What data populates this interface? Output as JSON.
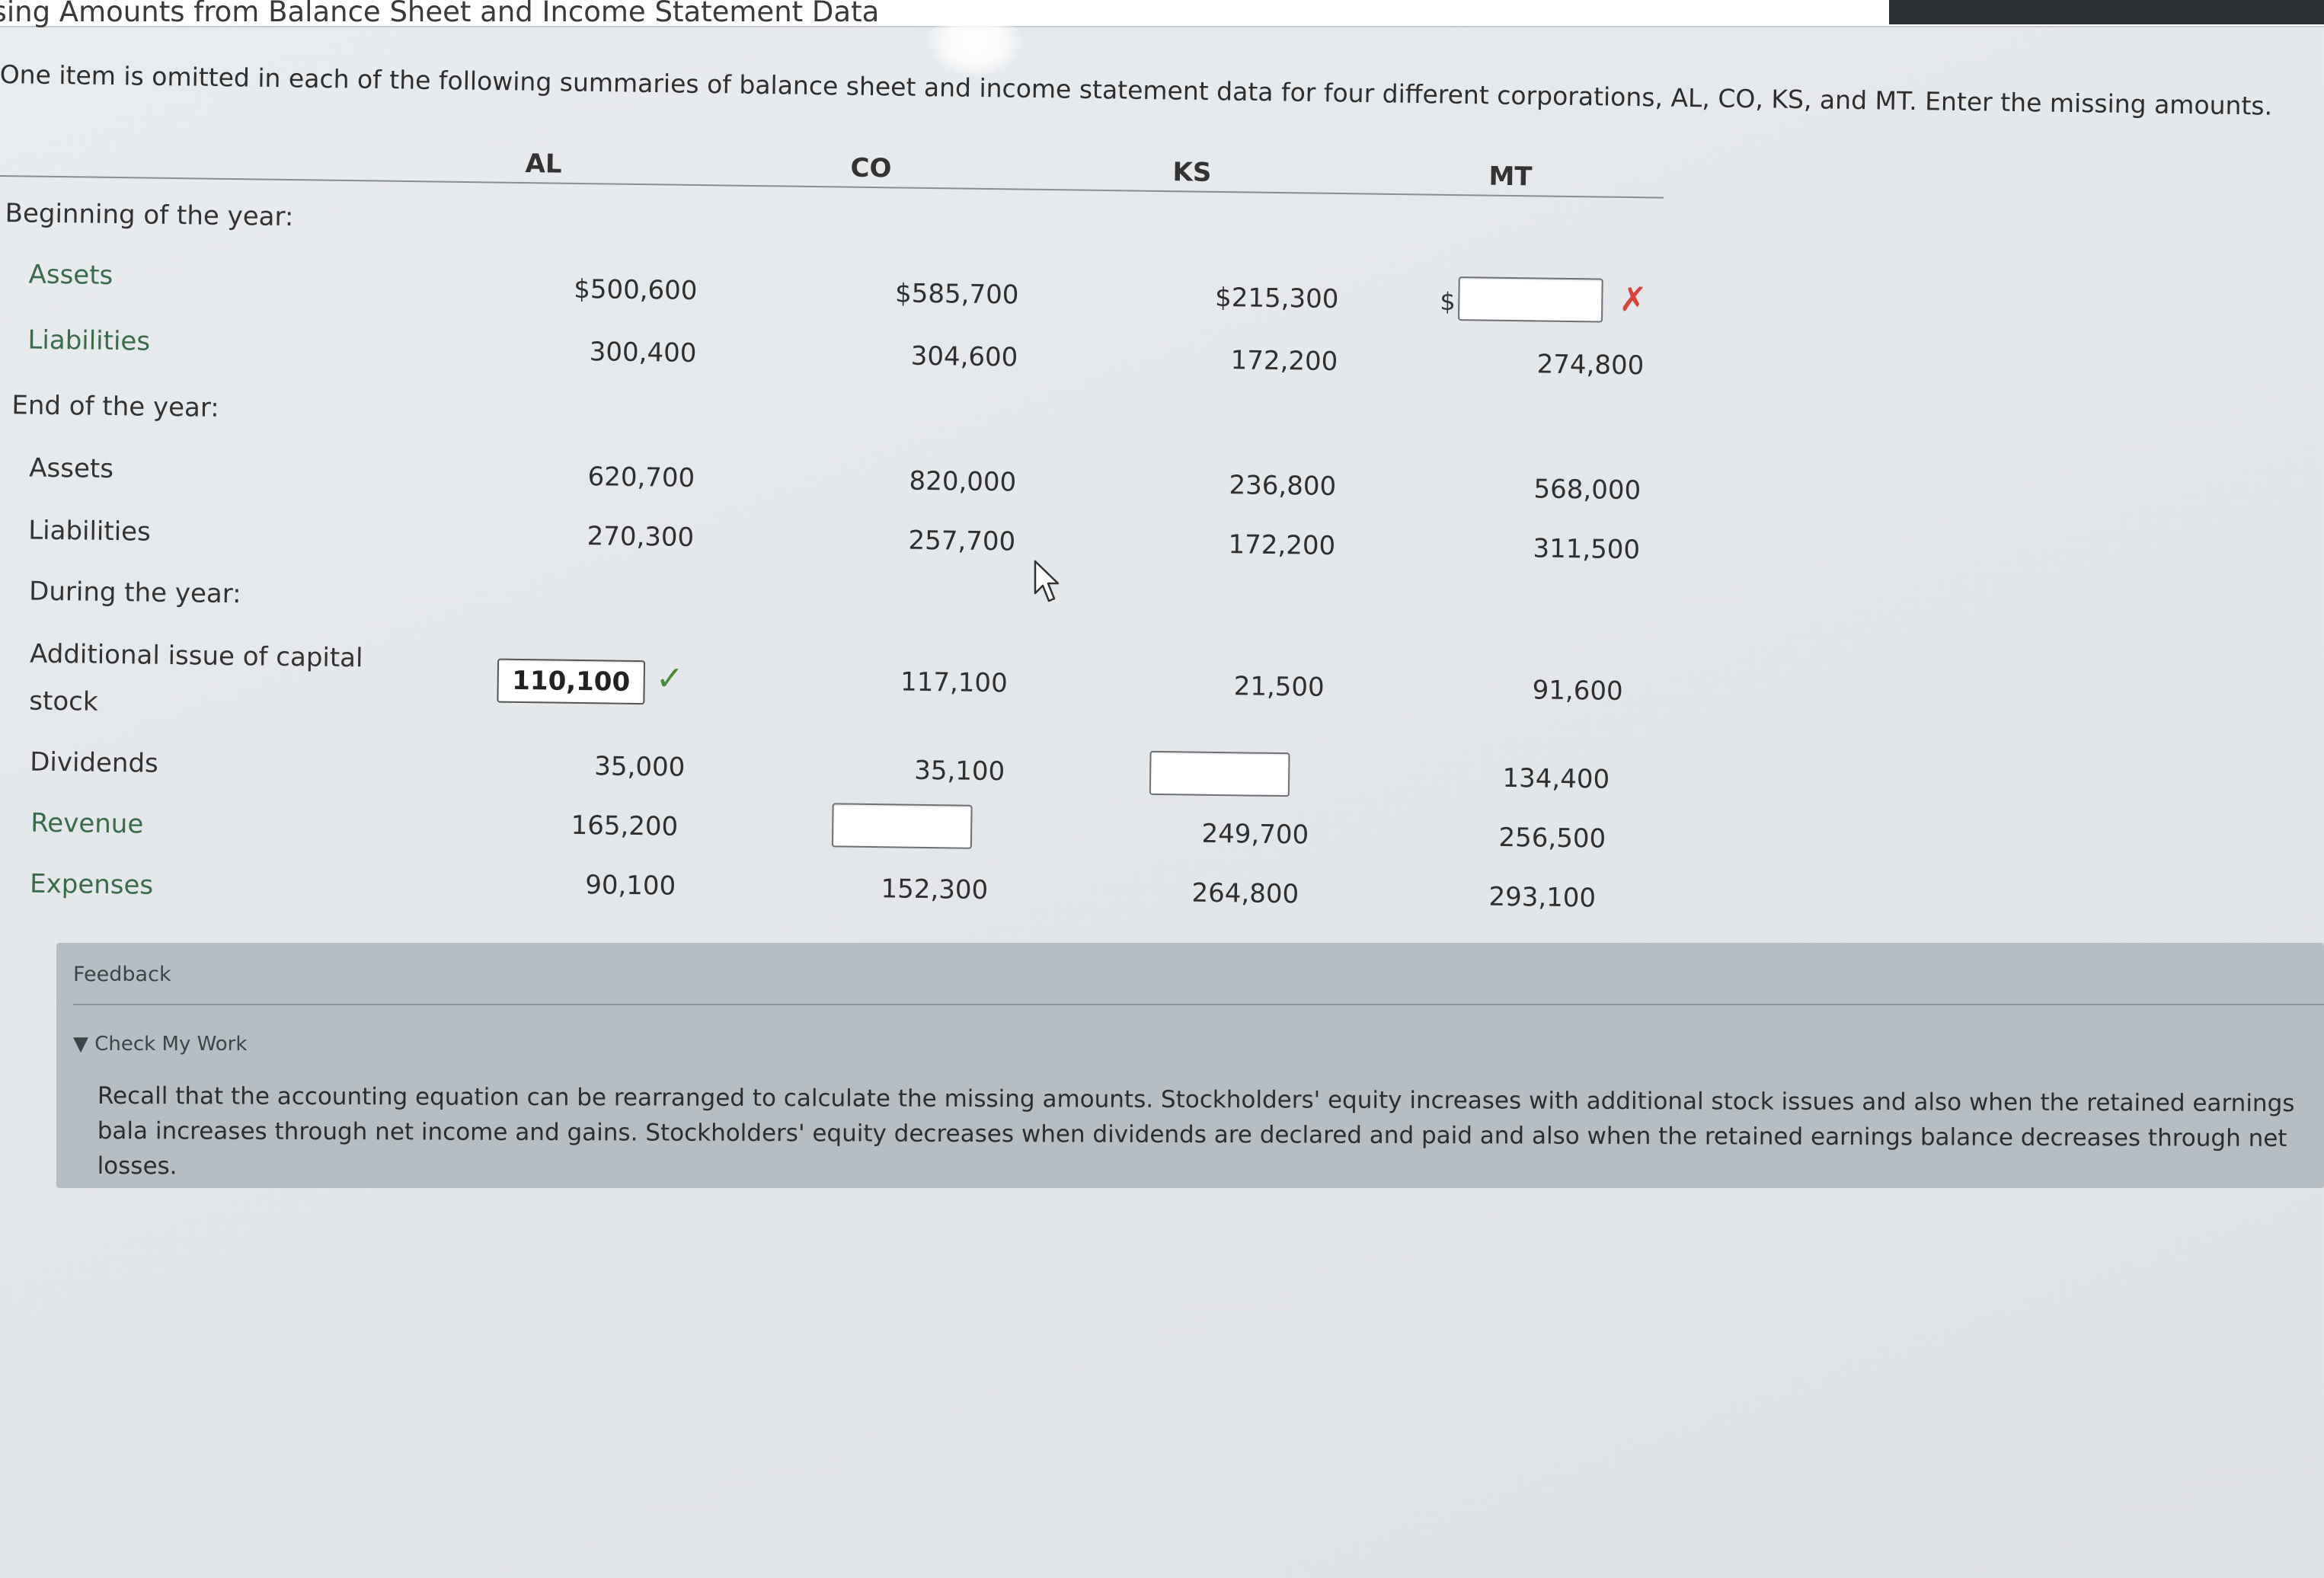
{
  "page": {
    "title": "issing Amounts from Balance Sheet and Income Statement Data",
    "instructions": "One item is omitted in each of the following summaries of balance sheet and income statement data for four different corporations, AL, CO, KS, and MT. Enter the missing amounts."
  },
  "table": {
    "columns": [
      "AL",
      "CO",
      "KS",
      "MT"
    ],
    "sections": {
      "beginning": "Beginning of the year:",
      "end": "End of the year:",
      "during": "During the year:"
    },
    "labels": {
      "assets_begin": "Assets",
      "liabilities_begin": "Liabilities",
      "assets_end": "Assets",
      "liabilities_end": "Liabilities",
      "capital_stock_line1": "Additional issue of capital",
      "capital_stock_line2": "stock",
      "dividends": "Dividends",
      "revenue": "Revenue",
      "expenses": "Expenses"
    },
    "values": {
      "assets_begin": [
        "$500,600",
        "$585,700",
        "$215,300",
        ""
      ],
      "liabilities_begin": [
        "300,400",
        "304,600",
        "172,200",
        "274,800"
      ],
      "assets_end": [
        "620,700",
        "820,000",
        "236,800",
        "568,000"
      ],
      "liabilities_end": [
        "270,300",
        "257,700",
        "172,200",
        "311,500"
      ],
      "capital_stock": [
        "110,100",
        "117,100",
        "21,500",
        "91,600"
      ],
      "dividends": [
        "35,000",
        "35,100",
        "",
        "134,400"
      ],
      "revenue": [
        "165,200",
        "",
        "249,700",
        "256,500"
      ],
      "expenses": [
        "90,100",
        "152,300",
        "264,800",
        "293,100"
      ]
    },
    "inputs": {
      "al_capital_stock": "110,100",
      "mt_assets_begin": "",
      "ks_dividends": "",
      "co_revenue": ""
    },
    "mt_dollar_sign": "$",
    "correct_mark": "✓",
    "incorrect_mark": "✗",
    "colors": {
      "correct": "#4a8a3a",
      "incorrect": "#d9443a"
    }
  },
  "feedback": {
    "title": "Feedback",
    "toggle_label": "▼ Check My Work",
    "text": "Recall that the accounting equation can be rearranged to calculate the missing amounts. Stockholders' equity increases with additional stock issues and also when the retained earnings bala increases through net income and gains. Stockholders' equity decreases when dividends are declared and paid and also when the retained earnings balance decreases through net losses."
  }
}
